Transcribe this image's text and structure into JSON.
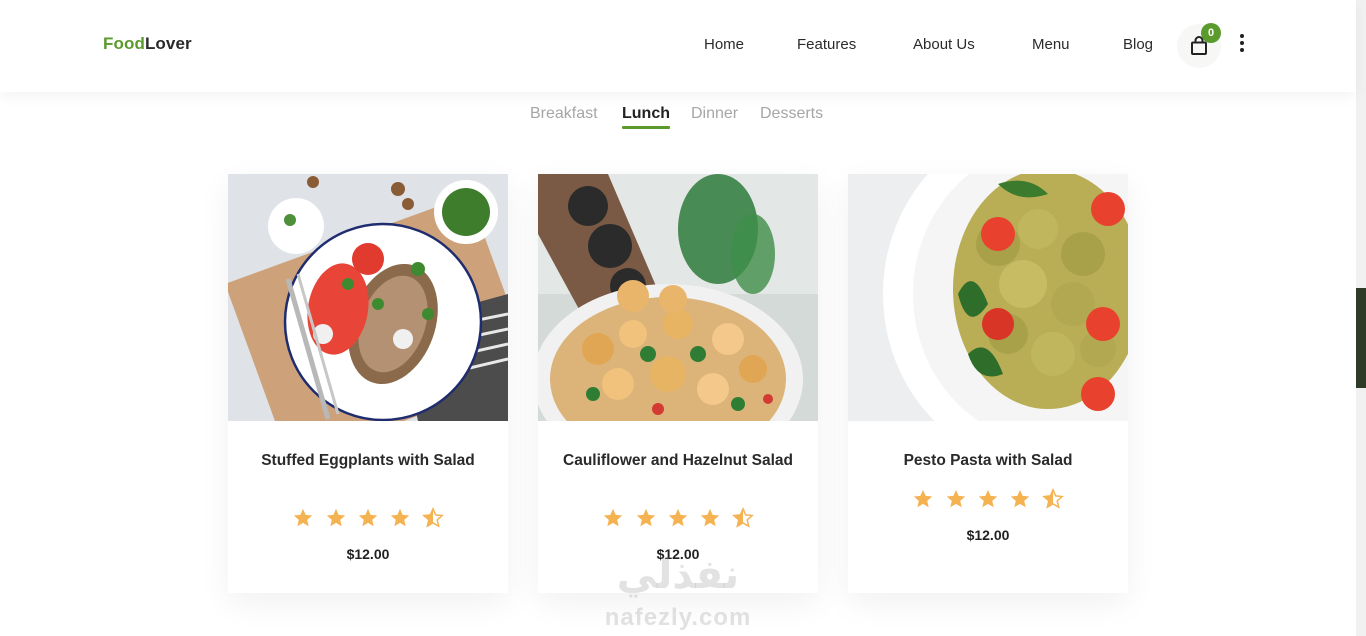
{
  "brand": {
    "part1": "Food",
    "part2": "Lover",
    "accent": "#5b9a2c"
  },
  "nav": {
    "items": [
      "Home",
      "Features",
      "About Us",
      "Menu",
      "Blog"
    ],
    "cart_count": "0",
    "cart_icon": "shopping-bag-icon",
    "more_icon": "vertical-dots-icon"
  },
  "tabs": {
    "items": [
      "Breakfast",
      "Lunch",
      "Dinner",
      "Desserts"
    ],
    "active": "Lunch"
  },
  "cards": [
    {
      "title": "Stuffed Eggplants with Salad",
      "rating": 4.5,
      "price": "$12.00"
    },
    {
      "title": "Cauliflower and Hazelnut Salad",
      "rating": 4.5,
      "price": "$12.00"
    },
    {
      "title": "Pesto Pasta with Salad",
      "rating": 4.5,
      "price": "$12.00"
    }
  ],
  "colors": {
    "star": "#f5b251",
    "scroll_thumb": "#2f3a27"
  },
  "watermark": {
    "arabic": "نفذلي",
    "latin": "nafezly.com"
  }
}
